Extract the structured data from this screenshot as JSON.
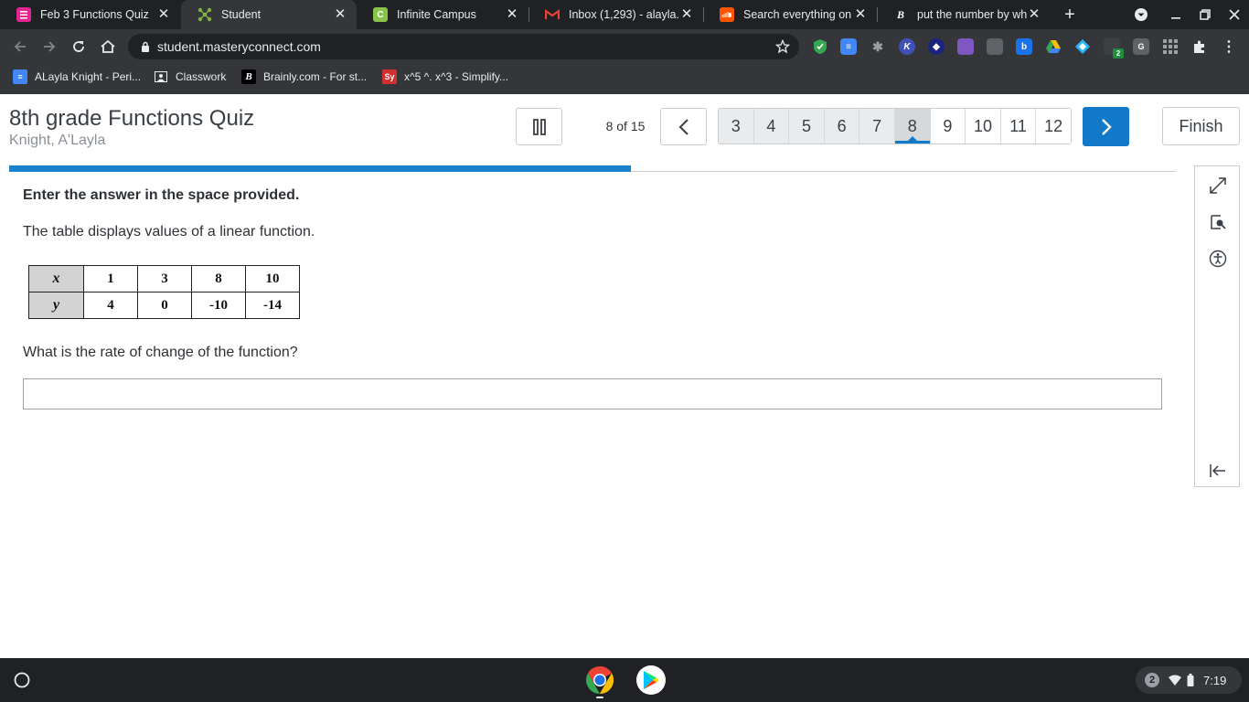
{
  "browser": {
    "tabs": [
      {
        "title": "Feb 3 Functions Quiz",
        "icon": "google-forms-icon",
        "color": "#e52592",
        "active": false
      },
      {
        "title": "Student",
        "icon": "masteryconnect-icon",
        "color": "#7cb342",
        "active": true
      },
      {
        "title": "Infinite Campus",
        "icon": "infinite-campus-icon",
        "color": "#8bc34a",
        "active": false
      },
      {
        "title": "Inbox (1,293) - alayla.kn",
        "icon": "gmail-icon",
        "color": "#ea4335",
        "active": false
      },
      {
        "title": "Search everything on So",
        "icon": "soundcloud-icon",
        "color": "#ff5500",
        "active": false
      },
      {
        "title": "put the number by whic",
        "icon": "brainly-icon",
        "color": "#ffffff",
        "active": false
      }
    ],
    "url": "student.masteryconnect.com",
    "bookmarks": [
      {
        "label": "ALayla Knight - Peri...",
        "icon": "docs-icon",
        "color": "#4285f4"
      },
      {
        "label": "Classwork",
        "icon": "classroom-icon",
        "color": "#e8eaed"
      },
      {
        "label": "Brainly.com - For st...",
        "icon": "brainly-icon",
        "color": "#000000"
      },
      {
        "label": "x^5 ^. x^3 - Simplify...",
        "icon": "symbolab-icon",
        "color": "#d32f2f",
        "badge": "Sy"
      }
    ]
  },
  "quiz": {
    "title": "8th grade Functions Quiz",
    "student": "Knight, A'Layla",
    "progress_label": "8 of 15",
    "progress_fraction": 0.533,
    "question_numbers": [
      "3",
      "4",
      "5",
      "6",
      "7",
      "8",
      "9",
      "10",
      "11",
      "12"
    ],
    "current_question": "8",
    "finish_label": "Finish",
    "accent_color": "#1279c8"
  },
  "question": {
    "instruction": "Enter the answer in the space provided.",
    "stem": "The table displays values of a linear function.",
    "table": {
      "x_label": "x",
      "y_label": "y",
      "x_values": [
        "1",
        "3",
        "8",
        "10"
      ],
      "y_values": [
        "4",
        "0",
        "-10",
        "-14"
      ]
    },
    "prompt": "What is the rate of change of the function?",
    "answer_value": ""
  },
  "shelf": {
    "apps": [
      "chrome-icon",
      "play-store-icon"
    ],
    "notification_count": "2",
    "time": "7:19"
  }
}
